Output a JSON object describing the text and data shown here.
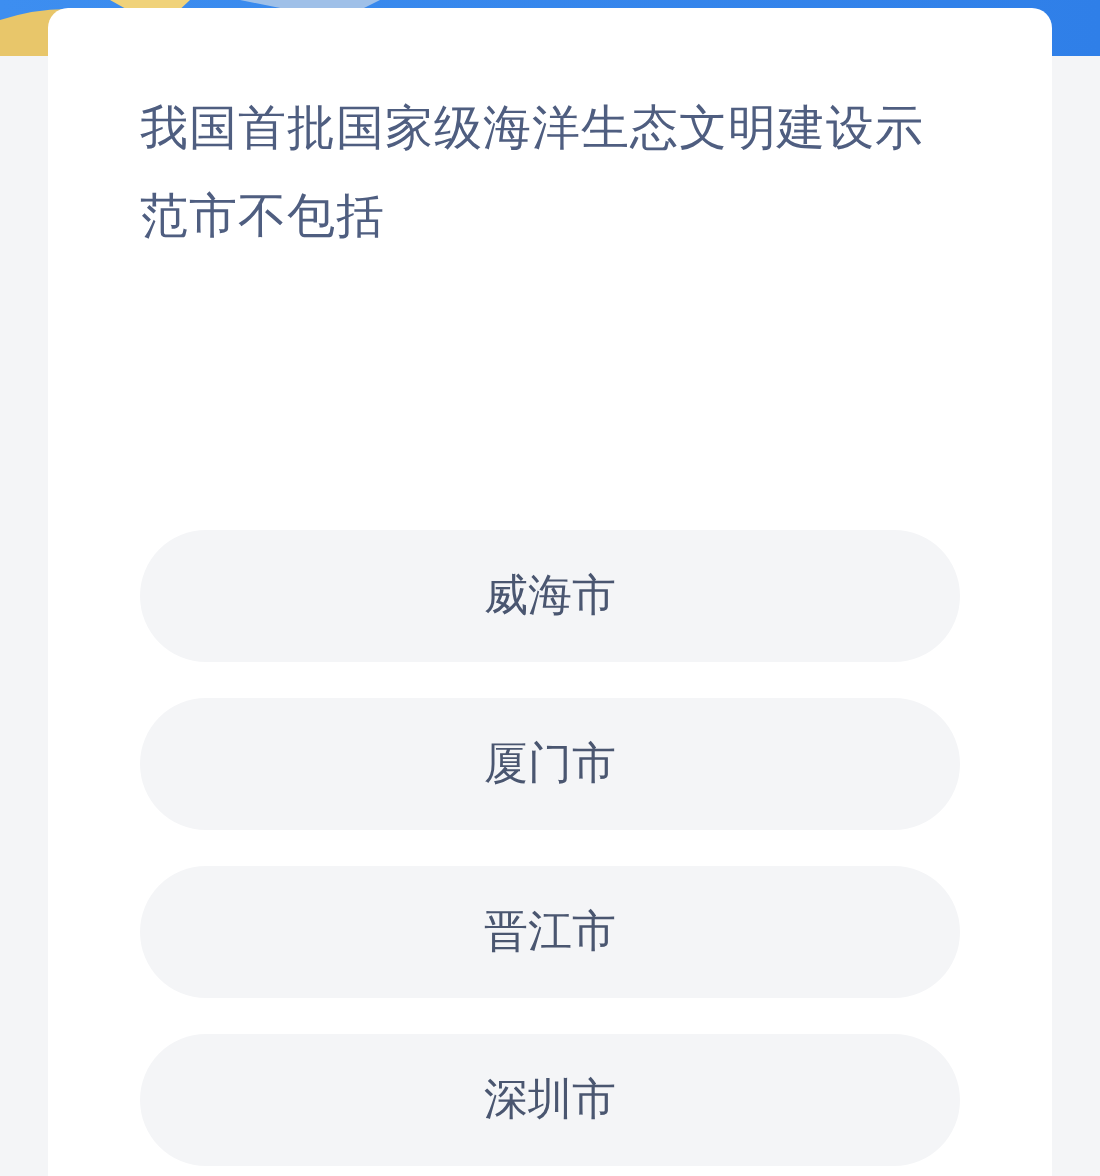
{
  "question": "我国首批国家级海洋生态文明建设示范市不包括",
  "options": [
    {
      "label": "威海市"
    },
    {
      "label": "厦门市"
    },
    {
      "label": "晋江市"
    },
    {
      "label": "深圳市"
    }
  ]
}
